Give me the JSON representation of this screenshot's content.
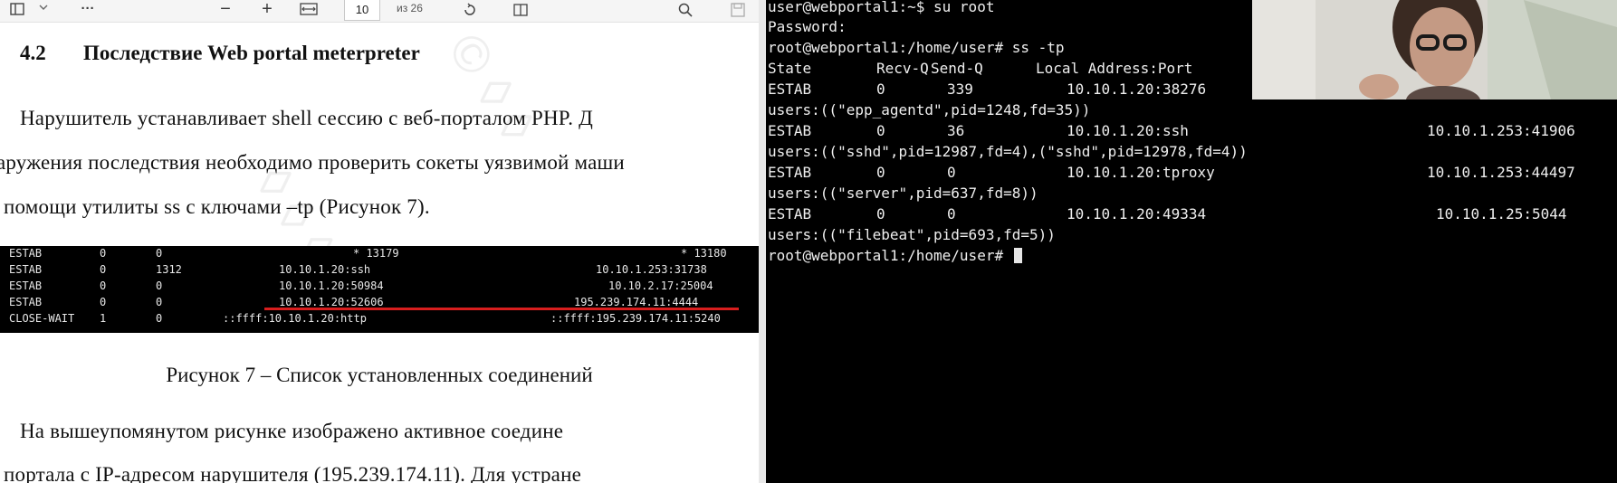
{
  "pdf_viewer": {
    "toolbar": {
      "page_current": "10",
      "page_of": "из 26",
      "icons": [
        "sidebar-icon",
        "chevron-down-icon",
        "more-icon",
        "zoom-out-icon",
        "zoom-in-icon",
        "fit-width-icon",
        "rotate-icon",
        "two-page-icon",
        "search-icon",
        "save-icon"
      ],
      "zoom_out": "−",
      "zoom_in": "+",
      "more": "···"
    },
    "document": {
      "heading_number": "4.2",
      "heading_text": "Последствие Web portal meterpreter",
      "paragraph1": [
        "Нарушитель устанавливает shell сессию с веб-порталом PHP. Д",
        "аружения последствия необходимо проверить сокеты уязвимой маши",
        "помощи утилиты ss с ключами –tp (Рисунок 7)."
      ],
      "figure_rows": [
        {
          "state": "ESTAB",
          "recvq": "0",
          "sendq": "0",
          "local": "* 13179",
          "peer": "* 13180"
        },
        {
          "state": "ESTAB",
          "recvq": "0",
          "sendq": "1312",
          "local": "10.10.1.20:ssh",
          "peer": "10.10.1.253:31738"
        },
        {
          "state": "ESTAB",
          "recvq": "0",
          "sendq": "0",
          "local": "10.10.1.20:50984",
          "peer": "10.10.2.17:25004"
        },
        {
          "state": "ESTAB",
          "recvq": "0",
          "sendq": "0",
          "local": "10.10.1.20:52606",
          "peer": "195.239.174.11:4444"
        },
        {
          "state": "CLOSE-WAIT",
          "recvq": "1",
          "sendq": "0",
          "local": "::ffff:10.10.1.20:http",
          "peer": "::ffff:195.239.174.11:5240"
        }
      ],
      "caption": "Рисунок 7 – Список установленных соединений",
      "paragraph2": [
        "На вышеупомянутом рисунке изображено активное соедине",
        "портала с IP-адресом нарушителя (195.239.174.11). Для устране"
      ],
      "highlight_color": "#d81e1e"
    }
  },
  "terminal": {
    "lines": [
      {
        "kind": "text",
        "text": "user@webportal1:~$ su root"
      },
      {
        "kind": "text",
        "text": "Password:"
      },
      {
        "kind": "text",
        "text": "root@webportal1:/home/user# ss -tp"
      },
      {
        "kind": "row",
        "state": "State",
        "recvq": "Recv-Q",
        "sendq": "Send-Q",
        "local": "Local Address:Port",
        "peer": ""
      },
      {
        "kind": "row",
        "state": "ESTAB",
        "recvq": "0",
        "sendq": "339",
        "local": "10.10.1.20:38276",
        "peer": ""
      },
      {
        "kind": "text",
        "text": "users:((\"epp_agentd\",pid=1248,fd=35))"
      },
      {
        "kind": "row",
        "state": "ESTAB",
        "recvq": "0",
        "sendq": "36",
        "local": "10.10.1.20:ssh",
        "peer": "10.10.1.253:41906"
      },
      {
        "kind": "text",
        "text": "users:((\"sshd\",pid=12987,fd=4),(\"sshd\",pid=12978,fd=4))"
      },
      {
        "kind": "row",
        "state": "ESTAB",
        "recvq": "0",
        "sendq": "0",
        "local": "10.10.1.20:tproxy",
        "peer": "10.10.1.253:44497"
      },
      {
        "kind": "text",
        "text": "users:((\"server\",pid=637,fd=8))"
      },
      {
        "kind": "row",
        "state": "ESTAB",
        "recvq": "0",
        "sendq": "0",
        "local": "10.10.1.20:49334",
        "peer": "10.10.1.25:5044"
      },
      {
        "kind": "text",
        "text": "users:((\"filebeat\",pid=693,fd=5))"
      },
      {
        "kind": "text",
        "text": "root@webportal1:/home/user# ",
        "cursor": true
      }
    ]
  },
  "webcam": {
    "icon": "webcam-person-icon"
  }
}
